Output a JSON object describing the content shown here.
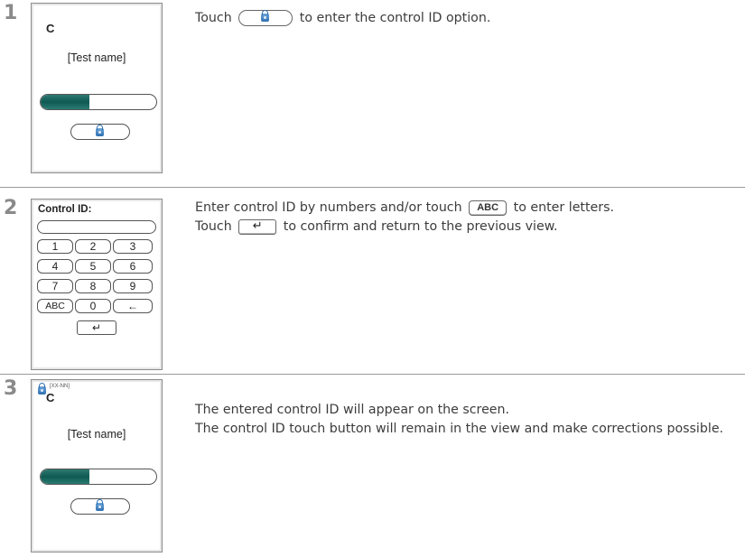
{
  "steps": [
    {
      "number": "1",
      "screen": {
        "letter": "C",
        "name": "[Test name]",
        "progress": 0.42
      },
      "text_before": "Touch",
      "text_after": "to enter the control ID option."
    },
    {
      "number": "2",
      "screen": {
        "title": "Control ID:",
        "keys": [
          "1",
          "2",
          "3",
          "4",
          "5",
          "6",
          "7",
          "8",
          "9",
          "ABC",
          "0",
          "←"
        ],
        "enter_key": "↵"
      },
      "line1_before": "Enter control ID by numbers and/or touch",
      "abc_label": "ABC",
      "line1_after": "to enter letters.",
      "line2_before": "Touch",
      "enter_icon": "↵",
      "line2_after": "to confirm and return to the previous view."
    },
    {
      "number": "3",
      "screen": {
        "id_tag": "[XX-NN]",
        "letter": "C",
        "name": "[Test name]",
        "progress": 0.42
      },
      "line1": "The entered control ID will appear on the screen.",
      "line2": "The control ID touch button will remain in the view and make corrections possible."
    }
  ],
  "icons": {
    "lock": "lock-icon",
    "enter": "enter-arrow-icon",
    "backspace": "backspace-arrow-icon"
  },
  "colors": {
    "progress_fill": "#0f5a52",
    "lock_blue": "#2e6fb1",
    "step_number": "#8a8a8a"
  }
}
